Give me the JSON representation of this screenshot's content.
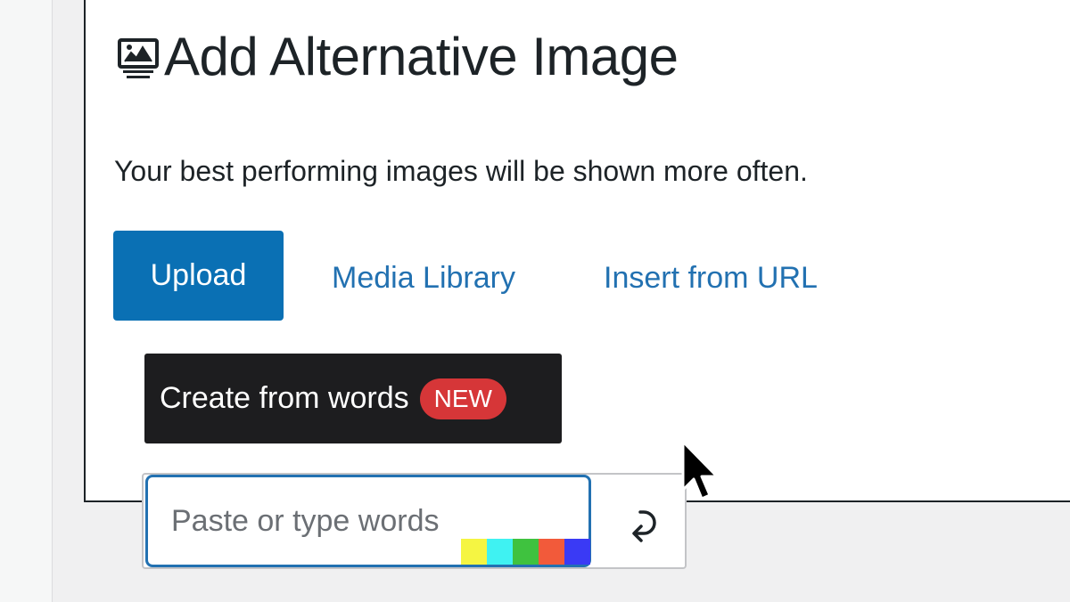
{
  "dialog": {
    "title": "Add Alternative Image",
    "title_icon": "image-gallery-icon",
    "description": "Your best performing images will be shown more often."
  },
  "tabs": {
    "upload_label": "Upload",
    "media_library_label": "Media Library",
    "insert_url_label": "Insert from URL"
  },
  "create": {
    "label": "Create from words",
    "badge": "NEW",
    "input_placeholder": "Paste or type words",
    "input_value": "",
    "submit_icon": "return-arrow-icon"
  },
  "swatches": [
    "#f5f542",
    "#3ff2f2",
    "#3fc23f",
    "#f25a3a",
    "#3a3af5"
  ],
  "colors": {
    "primary": "#0a70b4",
    "link": "#2271b1",
    "dark_button": "#1d1d1f",
    "badge": "#d63638"
  }
}
